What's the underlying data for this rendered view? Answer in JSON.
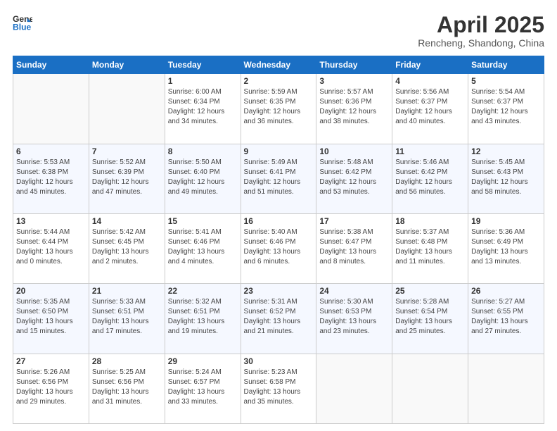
{
  "logo": {
    "line1": "General",
    "line2": "Blue"
  },
  "header": {
    "title": "April 2025",
    "subtitle": "Rencheng, Shandong, China"
  },
  "weekdays": [
    "Sunday",
    "Monday",
    "Tuesday",
    "Wednesday",
    "Thursday",
    "Friday",
    "Saturday"
  ],
  "weeks": [
    [
      {
        "day": "",
        "sunrise": "",
        "sunset": "",
        "daylight": ""
      },
      {
        "day": "",
        "sunrise": "",
        "sunset": "",
        "daylight": ""
      },
      {
        "day": "1",
        "sunrise": "Sunrise: 6:00 AM",
        "sunset": "Sunset: 6:34 PM",
        "daylight": "Daylight: 12 hours and 34 minutes."
      },
      {
        "day": "2",
        "sunrise": "Sunrise: 5:59 AM",
        "sunset": "Sunset: 6:35 PM",
        "daylight": "Daylight: 12 hours and 36 minutes."
      },
      {
        "day": "3",
        "sunrise": "Sunrise: 5:57 AM",
        "sunset": "Sunset: 6:36 PM",
        "daylight": "Daylight: 12 hours and 38 minutes."
      },
      {
        "day": "4",
        "sunrise": "Sunrise: 5:56 AM",
        "sunset": "Sunset: 6:37 PM",
        "daylight": "Daylight: 12 hours and 40 minutes."
      },
      {
        "day": "5",
        "sunrise": "Sunrise: 5:54 AM",
        "sunset": "Sunset: 6:37 PM",
        "daylight": "Daylight: 12 hours and 43 minutes."
      }
    ],
    [
      {
        "day": "6",
        "sunrise": "Sunrise: 5:53 AM",
        "sunset": "Sunset: 6:38 PM",
        "daylight": "Daylight: 12 hours and 45 minutes."
      },
      {
        "day": "7",
        "sunrise": "Sunrise: 5:52 AM",
        "sunset": "Sunset: 6:39 PM",
        "daylight": "Daylight: 12 hours and 47 minutes."
      },
      {
        "day": "8",
        "sunrise": "Sunrise: 5:50 AM",
        "sunset": "Sunset: 6:40 PM",
        "daylight": "Daylight: 12 hours and 49 minutes."
      },
      {
        "day": "9",
        "sunrise": "Sunrise: 5:49 AM",
        "sunset": "Sunset: 6:41 PM",
        "daylight": "Daylight: 12 hours and 51 minutes."
      },
      {
        "day": "10",
        "sunrise": "Sunrise: 5:48 AM",
        "sunset": "Sunset: 6:42 PM",
        "daylight": "Daylight: 12 hours and 53 minutes."
      },
      {
        "day": "11",
        "sunrise": "Sunrise: 5:46 AM",
        "sunset": "Sunset: 6:42 PM",
        "daylight": "Daylight: 12 hours and 56 minutes."
      },
      {
        "day": "12",
        "sunrise": "Sunrise: 5:45 AM",
        "sunset": "Sunset: 6:43 PM",
        "daylight": "Daylight: 12 hours and 58 minutes."
      }
    ],
    [
      {
        "day": "13",
        "sunrise": "Sunrise: 5:44 AM",
        "sunset": "Sunset: 6:44 PM",
        "daylight": "Daylight: 13 hours and 0 minutes."
      },
      {
        "day": "14",
        "sunrise": "Sunrise: 5:42 AM",
        "sunset": "Sunset: 6:45 PM",
        "daylight": "Daylight: 13 hours and 2 minutes."
      },
      {
        "day": "15",
        "sunrise": "Sunrise: 5:41 AM",
        "sunset": "Sunset: 6:46 PM",
        "daylight": "Daylight: 13 hours and 4 minutes."
      },
      {
        "day": "16",
        "sunrise": "Sunrise: 5:40 AM",
        "sunset": "Sunset: 6:46 PM",
        "daylight": "Daylight: 13 hours and 6 minutes."
      },
      {
        "day": "17",
        "sunrise": "Sunrise: 5:38 AM",
        "sunset": "Sunset: 6:47 PM",
        "daylight": "Daylight: 13 hours and 8 minutes."
      },
      {
        "day": "18",
        "sunrise": "Sunrise: 5:37 AM",
        "sunset": "Sunset: 6:48 PM",
        "daylight": "Daylight: 13 hours and 11 minutes."
      },
      {
        "day": "19",
        "sunrise": "Sunrise: 5:36 AM",
        "sunset": "Sunset: 6:49 PM",
        "daylight": "Daylight: 13 hours and 13 minutes."
      }
    ],
    [
      {
        "day": "20",
        "sunrise": "Sunrise: 5:35 AM",
        "sunset": "Sunset: 6:50 PM",
        "daylight": "Daylight: 13 hours and 15 minutes."
      },
      {
        "day": "21",
        "sunrise": "Sunrise: 5:33 AM",
        "sunset": "Sunset: 6:51 PM",
        "daylight": "Daylight: 13 hours and 17 minutes."
      },
      {
        "day": "22",
        "sunrise": "Sunrise: 5:32 AM",
        "sunset": "Sunset: 6:51 PM",
        "daylight": "Daylight: 13 hours and 19 minutes."
      },
      {
        "day": "23",
        "sunrise": "Sunrise: 5:31 AM",
        "sunset": "Sunset: 6:52 PM",
        "daylight": "Daylight: 13 hours and 21 minutes."
      },
      {
        "day": "24",
        "sunrise": "Sunrise: 5:30 AM",
        "sunset": "Sunset: 6:53 PM",
        "daylight": "Daylight: 13 hours and 23 minutes."
      },
      {
        "day": "25",
        "sunrise": "Sunrise: 5:28 AM",
        "sunset": "Sunset: 6:54 PM",
        "daylight": "Daylight: 13 hours and 25 minutes."
      },
      {
        "day": "26",
        "sunrise": "Sunrise: 5:27 AM",
        "sunset": "Sunset: 6:55 PM",
        "daylight": "Daylight: 13 hours and 27 minutes."
      }
    ],
    [
      {
        "day": "27",
        "sunrise": "Sunrise: 5:26 AM",
        "sunset": "Sunset: 6:56 PM",
        "daylight": "Daylight: 13 hours and 29 minutes."
      },
      {
        "day": "28",
        "sunrise": "Sunrise: 5:25 AM",
        "sunset": "Sunset: 6:56 PM",
        "daylight": "Daylight: 13 hours and 31 minutes."
      },
      {
        "day": "29",
        "sunrise": "Sunrise: 5:24 AM",
        "sunset": "Sunset: 6:57 PM",
        "daylight": "Daylight: 13 hours and 33 minutes."
      },
      {
        "day": "30",
        "sunrise": "Sunrise: 5:23 AM",
        "sunset": "Sunset: 6:58 PM",
        "daylight": "Daylight: 13 hours and 35 minutes."
      },
      {
        "day": "",
        "sunrise": "",
        "sunset": "",
        "daylight": ""
      },
      {
        "day": "",
        "sunrise": "",
        "sunset": "",
        "daylight": ""
      },
      {
        "day": "",
        "sunrise": "",
        "sunset": "",
        "daylight": ""
      }
    ]
  ]
}
